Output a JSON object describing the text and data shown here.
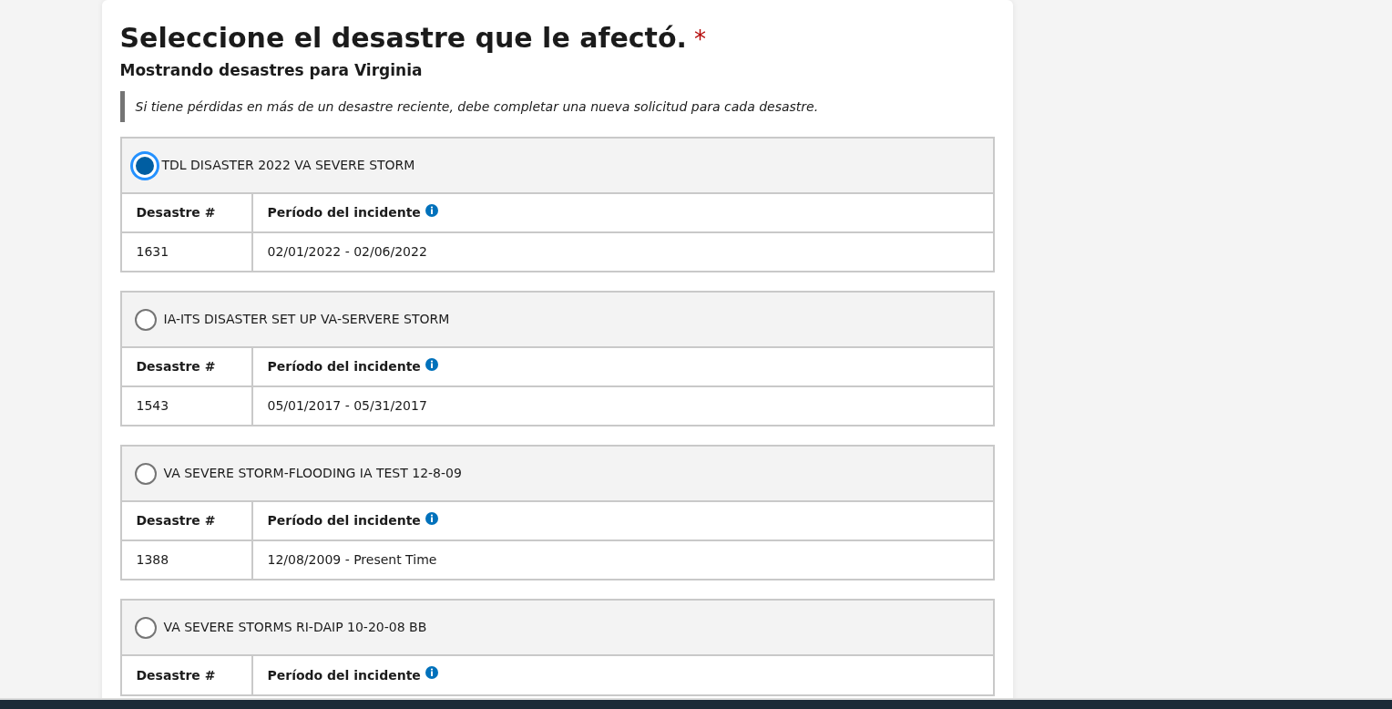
{
  "heading": {
    "title": "Seleccione el desastre que le afectó.",
    "required_mark": "*",
    "subtitle": "Mostrando desastres para Virginia"
  },
  "note": "Si tiene pérdidas en más de un desastre reciente, debe completar una nueva solicitud para cada desastre.",
  "disasters": [
    {
      "name": "TDL DISASTER 2022 VA SEVERE STORM",
      "selected": true,
      "columns": [
        "Desastre #",
        "Período del incidente"
      ],
      "row": [
        "1631",
        "02/01/2022 - 02/06/2022"
      ]
    },
    {
      "name": "IA-ITS DISASTER SET UP VA-SERVERE STORM",
      "selected": false,
      "columns": [
        "Desastre #",
        "Período del incidente"
      ],
      "row": [
        "1543",
        "05/01/2017 - 05/31/2017"
      ]
    },
    {
      "name": "VA SEVERE STORM-FLOODING IA TEST 12-8-09",
      "selected": false,
      "columns": [
        "Desastre #",
        "Período del incidente"
      ],
      "row": [
        "1388",
        "12/08/2009 - Present Time"
      ]
    },
    {
      "name": "VA SEVERE STORMS RI-DAIP 10-20-08 BB",
      "selected": false,
      "columns": [
        "Desastre #",
        "Período del incidente"
      ]
    }
  ]
}
